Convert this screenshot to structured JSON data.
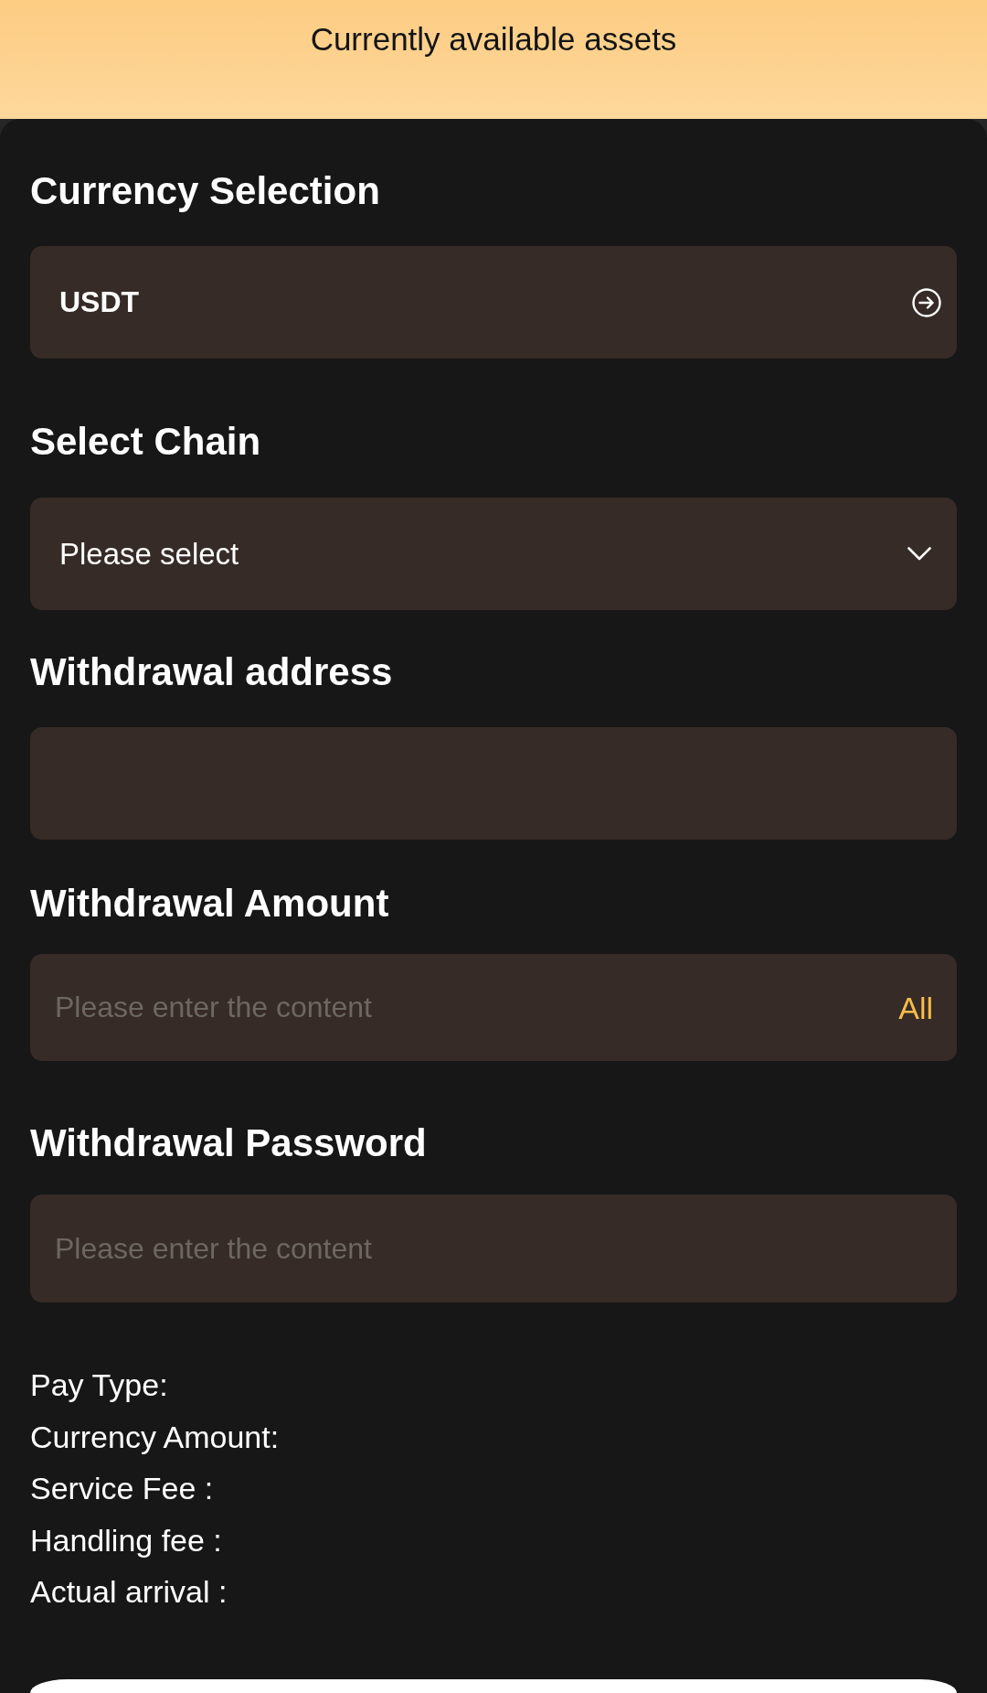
{
  "header": {
    "title": "Currently available assets"
  },
  "sections": [
    {
      "label": "Currency Selection",
      "field": {
        "kind": "picker",
        "value": "USDT"
      }
    },
    {
      "label": "Select Chain",
      "field": {
        "kind": "dropdown",
        "value": "Please select"
      }
    },
    {
      "label": "Withdrawal address",
      "field": {
        "kind": "input"
      }
    },
    {
      "label": "Withdrawal Amount",
      "field": {
        "kind": "input",
        "placeholder": "Please enter the content",
        "action": "All"
      }
    },
    {
      "label": "Withdrawal Password",
      "field": {
        "kind": "input",
        "placeholder": "Please enter the content"
      }
    }
  ],
  "summary": [
    "Pay Type:",
    "Currency Amount:",
    "Service Fee :",
    "Handling fee :",
    "Actual arrival :"
  ]
}
